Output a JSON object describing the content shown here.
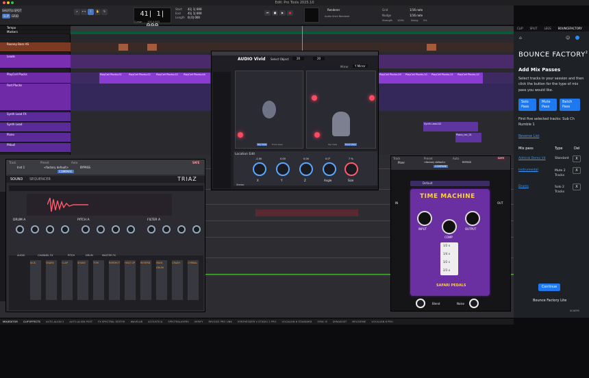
{
  "window": {
    "title": "Edit: Pro Tools 2025.10"
  },
  "toolbar": {
    "modes": [
      "SHUFFLE",
      "SPOT",
      "SLIP",
      "GRID"
    ],
    "counter": "41| 1| 000",
    "cursor_label": "Cursor",
    "cursor_value": "100.4.443",
    "start_label": "Start",
    "end_label": "End",
    "length_label": "Length",
    "start": "41| 1| 000",
    "end": "41| 1| 000",
    "length": "0| 0| 000",
    "renderer_label": "Renderer",
    "renderer_value": "Audio Vivid Renderer",
    "grid_label": "Grid",
    "grid_value": "1/16 note",
    "nudge_label": "Nudge",
    "nudge_value": "1/16 note",
    "strength_label": "Strength",
    "strength_value": "100%",
    "swing_label": "Swing",
    "swing_value": "0%"
  },
  "tracks": [
    {
      "name": "Tempo"
    },
    {
      "name": "Markers"
    },
    {
      "name": "Rooney Bass AS"
    },
    {
      "name": "Leads"
    },
    {
      "name": "PlayCell Plucks"
    },
    {
      "name": "Fast Plucks"
    },
    {
      "name": "Synth Lead FX"
    },
    {
      "name": "Synth Lead"
    },
    {
      "name": "Piano"
    },
    {
      "name": "Pitbull"
    }
  ],
  "clips": [
    {
      "label": "PlayCell Plucks-01"
    },
    {
      "label": "PlayCell Plucks-02"
    },
    {
      "label": "PlayCell Plucks-03"
    },
    {
      "label": "PlayCell Plucks-04"
    },
    {
      "label": "PlayCell Plucks-09"
    },
    {
      "label": "PlayCell Plucks-10"
    },
    {
      "label": "PlayCell Plucks-11"
    },
    {
      "label": "PlayCell Plucks-12"
    },
    {
      "label": "Synth Lead-02"
    },
    {
      "label": "Piano_rec_01"
    },
    {
      "label": "Stereo"
    }
  ],
  "triaz": {
    "track_label": "Track",
    "preset_label": "Preset",
    "auto_label": "Auto",
    "track_name": "Inst 1",
    "preset_name": "<factory default>",
    "compare": "COMPARE",
    "bypass": "BYPASS",
    "safe": "SAFE",
    "title": "TRIAZ",
    "tab_sound": "SOUND",
    "tab_sequencer": "SEQUENCER",
    "drum": "DRUM A",
    "pitch": "PITCH A",
    "filter": "FILTER A",
    "pad_labels": [
      "KICK",
      "SNARE",
      "CLAP",
      "SHAKE",
      "TOM",
      "RIMSHOT",
      "HEAT UP",
      "REVERB",
      "MAIN DRUM",
      "CRASH",
      "CYMBAL"
    ],
    "mixer_labels": [
      "AUDIO",
      "CHANNEL FX",
      "PITCH",
      "DRUM",
      "MASTER FX"
    ],
    "knob_labels": [
      "Start",
      "Drive",
      "Decay",
      "End Pitch",
      "Cutoff",
      "Res",
      "LFO1",
      "Attack",
      "Hold",
      "Decay",
      "Velocity",
      "Envelope",
      "Attack",
      "Decay",
      "Envelope",
      "Velocity"
    ]
  },
  "vivid": {
    "title": "AUDIO Vivid",
    "select_object_label": "Select Object",
    "object": "20",
    "object2": "20",
    "mirror_label": "Mirror",
    "mirror_value": "Y Mirror",
    "view_buttons": [
      "Top View",
      "Front View",
      "Top View",
      "Front View"
    ],
    "location_edit": "Location Edit",
    "knob_values": [
      "-1.00",
      "0.00",
      "0.00",
      "0.0°",
      "7 %"
    ],
    "knob_labels": [
      "X",
      "Y",
      "Z",
      "Angle",
      "Size"
    ],
    "mode": "Stereo"
  },
  "timemachine": {
    "track_label": "Track",
    "preset_label": "Preset",
    "auto_label": "Auto",
    "track_name": "Pianr",
    "preset_name": "<factory default>",
    "compare": "COMPARE",
    "bypass": "BYPASS",
    "safe": "SAFE",
    "preset_display": "Default",
    "title": "TIME MACHINE",
    "in_label": "IN",
    "out_label": "OUT",
    "knob_labels": [
      "INPUT",
      "COMP",
      "OUTPUT"
    ],
    "multipliers": [
      "1/2 x",
      "1/4 x",
      "3/2 x",
      "2/3 x"
    ],
    "brand": "SAFARI PEDALS",
    "blend": "Blend",
    "noise": "Noise"
  },
  "panel": {
    "tabs": [
      "CLIP",
      "SPLIT",
      "LEGS",
      "BOUNCEFACTORY"
    ],
    "brand": "BOUNCE FACTORY",
    "brand_sup": "2",
    "heading": "Add Mix Passes",
    "instructions": "Select tracks in your session and then click the button for the type of mix pass you would like.",
    "buttons": [
      "Solo Pass",
      "Mute Pass",
      "Batch Pass"
    ],
    "selection_text": "First five selected tracks: Sub Ch Rumble 1",
    "reverse_link": "Reverse List",
    "col_headers": [
      "Mix pass",
      "Type",
      "Del"
    ],
    "rows": [
      {
        "name": "Admiral Demo V4",
        "type": "Standard",
        "del": "X"
      },
      {
        "name": "Instrumental",
        "type": "Mute 2 Tracks",
        "del": "X"
      },
      {
        "name": "Drums",
        "type": "Solo 2 Tracks",
        "del": "X"
      }
    ],
    "continue": "Continue",
    "footer": "Bounce Factory Lite",
    "logo": "SCHEPS"
  },
  "status_tabs": [
    "MIX/EDITOR",
    "CLIP EFFECTS",
    "AUTO-ALIGN 2",
    "AUTO-ALIGN POST",
    "FX SPECTRAL EDITOR",
    "WAVELAB",
    "ACOUSTICA",
    "SPECTRALAYERS",
    "VERIFY",
    "REVOICE PRO LINK",
    "SYNTHESIZER V STUDIO 2 PRO",
    "VOCALIGN 6 STANDARD",
    "SYNC IS",
    "DYNASSIST",
    "MELODYNE",
    "VOCALIGN 6 PRO"
  ]
}
